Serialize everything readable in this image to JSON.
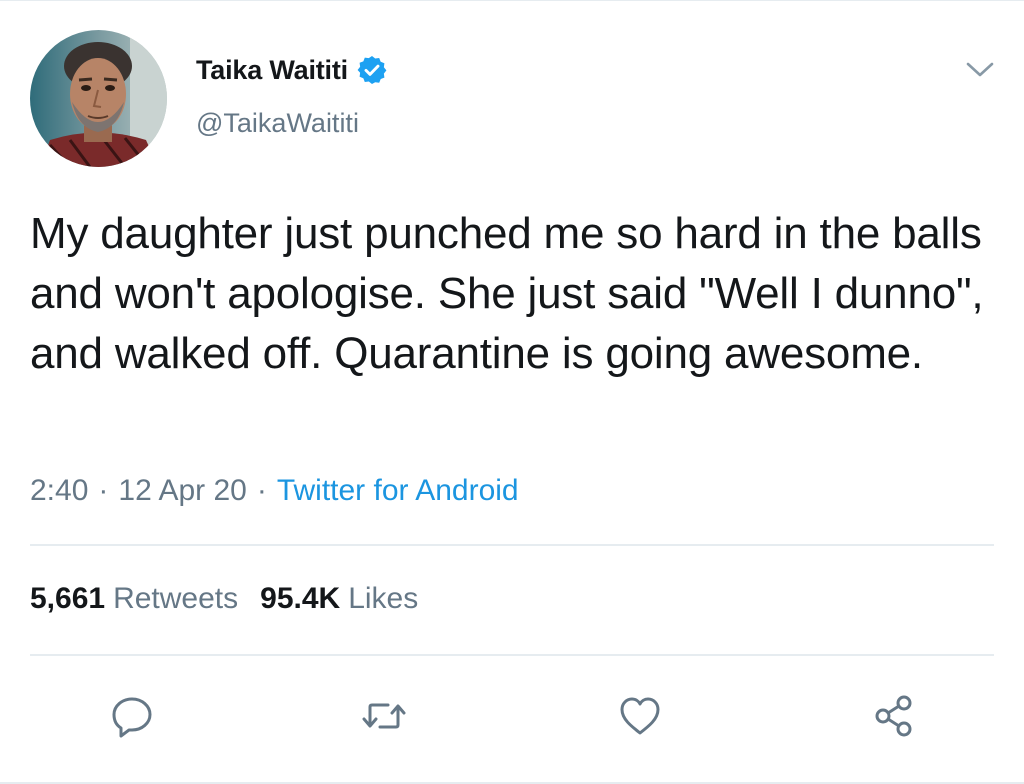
{
  "tweet": {
    "author": {
      "display_name": "Taika Waititi",
      "handle": "@TaikaWaititi",
      "verified": true,
      "avatar_icon": "profile-photo"
    },
    "text": "My daughter just punched me so hard in the balls and won't apologise. She just said \"Well I dunno\", and walked off. Quarantine is going awesome.",
    "time": "2:40",
    "date": "12 Apr 20",
    "separator": "·",
    "source": "Twitter for Android",
    "stats": {
      "retweets_count": "5,661",
      "retweets_label": "Retweets",
      "likes_count": "95.4K",
      "likes_label": "Likes"
    },
    "actions": [
      "reply-icon",
      "retweet-icon",
      "like-icon",
      "share-icon"
    ]
  },
  "colors": {
    "text": "#14171a",
    "secondary": "#657786",
    "link": "#1b95e0",
    "verified": "#1da1f2",
    "divider": "#e6ecf0"
  }
}
